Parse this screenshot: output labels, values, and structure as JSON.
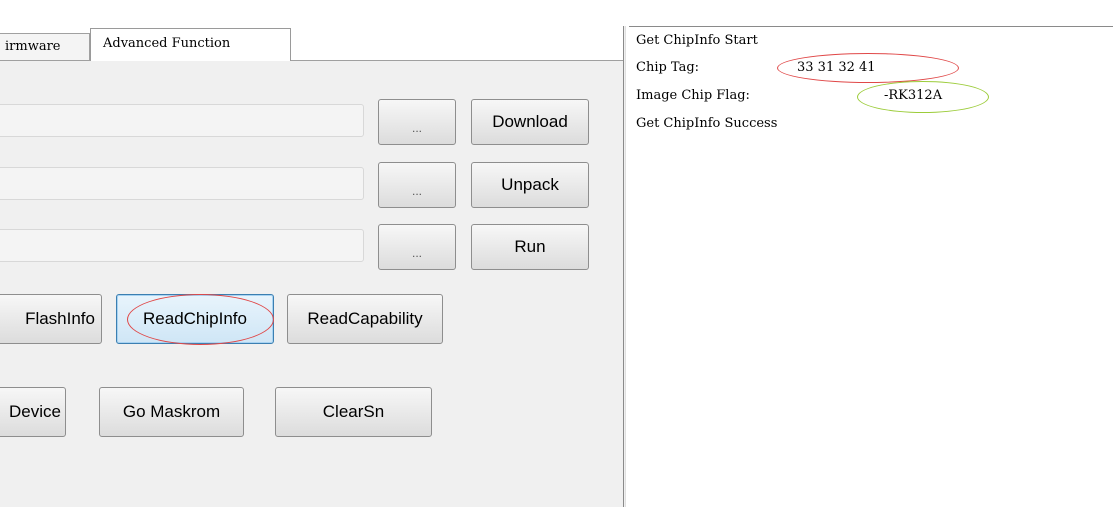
{
  "tabs": {
    "firmware_label": "irmware",
    "advanced_label": "Advanced Function"
  },
  "rows": [
    {
      "browse_label": "...",
      "action_label": "Download"
    },
    {
      "browse_label": "...",
      "action_label": "Unpack"
    },
    {
      "browse_label": "...",
      "action_label": "Run"
    }
  ],
  "info_buttons": {
    "flashinfo_label": "FlashInfo",
    "readchipinfo_label": "ReadChipInfo",
    "readcapability_label": "ReadCapability"
  },
  "device_buttons": {
    "device_label": "Device",
    "gomaskrom_label": "Go Maskrom",
    "clearsn_label": "ClearSn"
  },
  "log": {
    "line1": "Get ChipInfo Start",
    "chip_tag_label": "Chip Tag:",
    "chip_tag_value": "33 31 32 41",
    "image_chip_flag_label": "Image Chip Flag:",
    "image_chip_flag_value": "-RK312A",
    "line4": "Get ChipInfo Success"
  },
  "annotation_colors": {
    "red_ellipse": "#e04848",
    "green_ellipse": "#9ccc3a",
    "highlight_button_border": "#3c7fb1"
  }
}
